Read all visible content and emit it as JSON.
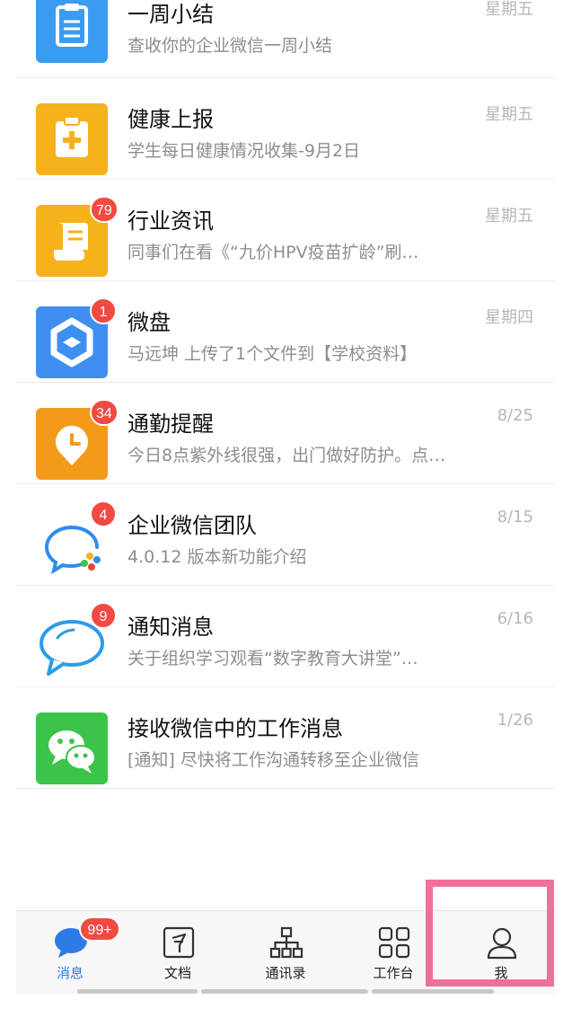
{
  "messages": [
    {
      "title": "一周小结",
      "subtitle": "查收你的企业微信一周小结",
      "time": "星期五",
      "badge": "",
      "icon": "clipboard-icon",
      "color": "#3a9cf0"
    },
    {
      "title": "健康上报",
      "subtitle": "学生每日健康情况收集-9月2日",
      "time": "星期五",
      "badge": "",
      "icon": "health-report-icon",
      "color": "#f6b21b"
    },
    {
      "title": "行业资讯",
      "subtitle": "同事们在看《“九价HPV疫苗扩龄”刷…",
      "time": "星期五",
      "badge": "79",
      "icon": "news-scroll-icon",
      "color": "#f6b21b"
    },
    {
      "title": "微盘",
      "subtitle": "马远坤 上传了1个文件到【学校资料】",
      "time": "星期四",
      "badge": "1",
      "icon": "weipan-icon",
      "color": "#3f8ff0"
    },
    {
      "title": "通勤提醒",
      "subtitle": "今日8点紫外线很强，出门做好防护。点…",
      "time": "8/25",
      "badge": "34",
      "icon": "commute-clock-icon",
      "color": "#f49a1a"
    },
    {
      "title": "企业微信团队",
      "subtitle": "4.0.12 版本新功能介绍",
      "time": "8/15",
      "badge": "4",
      "icon": "wecom-logo-icon",
      "color": "#ffffff"
    },
    {
      "title": "通知消息",
      "subtitle": "关于组织学习观看“数字教育大讲堂”…",
      "time": "6/16",
      "badge": "9",
      "icon": "speech-bubble-icon",
      "color": "#ffffff"
    },
    {
      "title": "接收微信中的工作消息",
      "subtitle": "[通知] 尽快将工作沟通转移至企业微信",
      "time": "1/26",
      "badge": "",
      "icon": "wechat-icon",
      "color": "#3cc34a"
    }
  ],
  "tabbar": {
    "tabs": [
      {
        "label": "消息",
        "icon": "chat-bubble-icon",
        "badge": "99+",
        "active": true
      },
      {
        "label": "文档",
        "icon": "document-icon",
        "badge": "",
        "active": false
      },
      {
        "label": "通讯录",
        "icon": "org-chart-icon",
        "badge": "",
        "active": false
      },
      {
        "label": "工作台",
        "icon": "grid-icon",
        "badge": "",
        "active": false
      },
      {
        "label": "我",
        "icon": "person-icon",
        "badge": "",
        "active": false
      }
    ]
  },
  "colors": {
    "accent": "#2e7be6",
    "badge": "#f04a43",
    "highlight": "#ef6f9d"
  }
}
